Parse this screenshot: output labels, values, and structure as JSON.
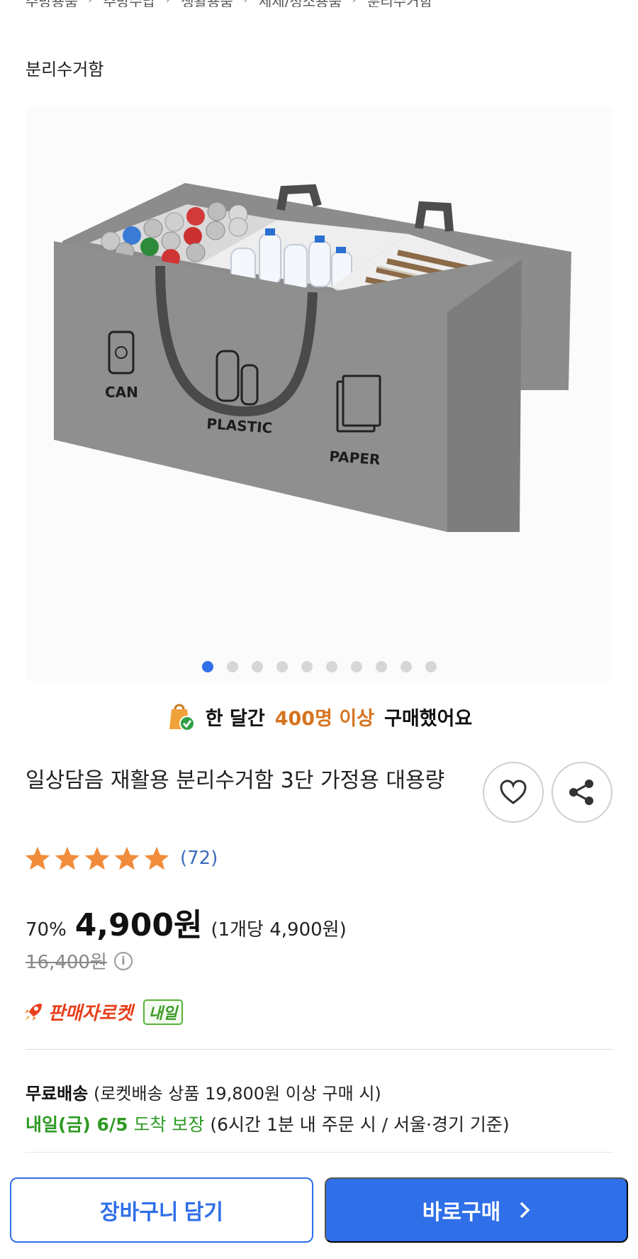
{
  "breadcrumb": [
    "주방용품",
    "주방수납",
    "생활용품",
    "세제/청소용품",
    "분리수거함"
  ],
  "category": "분리수거함",
  "gallery": {
    "bag_labels": [
      "CAN",
      "PLASTIC",
      "PAPER"
    ],
    "dot_count": 10,
    "active_index": 0
  },
  "social_proof": {
    "prefix": "한 달간",
    "highlight": "400명 이상",
    "suffix": "구매했어요"
  },
  "product": {
    "title": "일상담음 재활용 분리수거함 3단 가정용 대용량",
    "rating": 5,
    "review_count": "(72)"
  },
  "price": {
    "discount": "70%",
    "sale": "4,900원",
    "per_unit": "(1개당 4,900원)",
    "original": "16,400원"
  },
  "delivery": {
    "rocket_label": "판매자로켓",
    "badge": "내일",
    "free_label": "무료배송",
    "free_condition": "(로켓배송 상품 19,800원 이상 구매 시)",
    "arrival_date": "내일(금) 6/5",
    "arrival_guarantee": "도착 보장",
    "arrival_condition": "(6시간 1분 내 주문 시 / 서울·경기 기준)"
  },
  "actions": {
    "cart": "장바구니 담기",
    "buy": "바로구매"
  },
  "colors": {
    "accent": "#2f6fe8",
    "highlight": "#d5741f",
    "star": "#f08c3a",
    "rocket": "#e8401c",
    "delivery_green": "#2e9a23"
  }
}
